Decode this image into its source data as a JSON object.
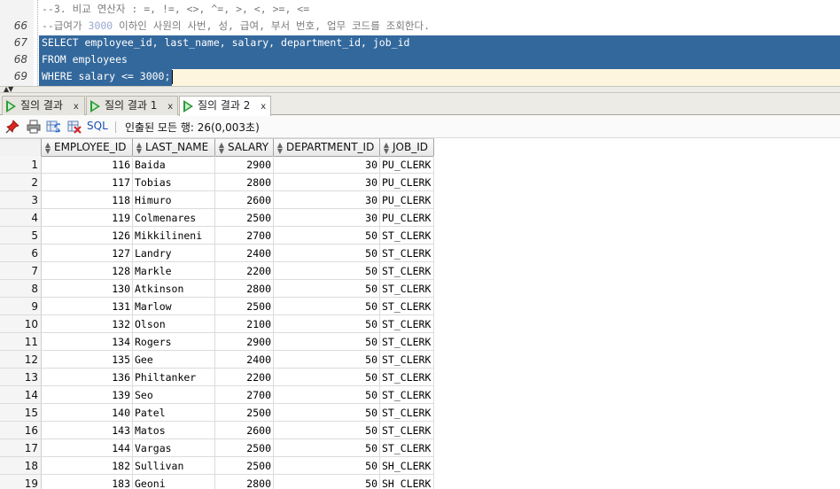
{
  "editor": {
    "lines": [
      {
        "num": "66",
        "text": "--3. 비교 연산자 : =, !=, <>, ^=, >, <, >=, <=",
        "kind": "comment"
      },
      {
        "num": "67",
        "pre": "--급여가 ",
        "numtext": "3000",
        "post": " 이하인 사원의 사번, 성, 급여, 부서 번호, 업무 코드를 조회한다.",
        "kind": "comment-num"
      },
      {
        "num": "68",
        "text": "SELECT employee_id, last_name, salary, department_id, job_id",
        "kind": "selected"
      },
      {
        "num": "69",
        "text": "FROM employees",
        "kind": "selected"
      },
      {
        "num": "70",
        "text": "WHERE salary <= 3000;",
        "kind": "selected-caret"
      }
    ]
  },
  "tabs": [
    {
      "label": "질의 결과",
      "close": "x",
      "active": false
    },
    {
      "label": "질의 결과 1",
      "close": "x",
      "active": false
    },
    {
      "label": "질의 결과 2",
      "close": "x",
      "active": true
    }
  ],
  "toolbar": {
    "sql_label": "SQL",
    "status": "인출된 모든 행: 26(0,003초)",
    "icons": [
      "pin-icon",
      "print-icon",
      "refresh-icon",
      "delete-icon"
    ]
  },
  "grid": {
    "columns": [
      "EMPLOYEE_ID",
      "LAST_NAME",
      "SALARY",
      "DEPARTMENT_ID",
      "JOB_ID"
    ],
    "rows": [
      {
        "n": "1",
        "emp": "116",
        "last": "Baida",
        "sal": "2900",
        "dept": "30",
        "job": "PU_CLERK"
      },
      {
        "n": "2",
        "emp": "117",
        "last": "Tobias",
        "sal": "2800",
        "dept": "30",
        "job": "PU_CLERK"
      },
      {
        "n": "3",
        "emp": "118",
        "last": "Himuro",
        "sal": "2600",
        "dept": "30",
        "job": "PU_CLERK"
      },
      {
        "n": "4",
        "emp": "119",
        "last": "Colmenares",
        "sal": "2500",
        "dept": "30",
        "job": "PU_CLERK"
      },
      {
        "n": "5",
        "emp": "126",
        "last": "Mikkilineni",
        "sal": "2700",
        "dept": "50",
        "job": "ST_CLERK"
      },
      {
        "n": "6",
        "emp": "127",
        "last": "Landry",
        "sal": "2400",
        "dept": "50",
        "job": "ST_CLERK"
      },
      {
        "n": "7",
        "emp": "128",
        "last": "Markle",
        "sal": "2200",
        "dept": "50",
        "job": "ST_CLERK"
      },
      {
        "n": "8",
        "emp": "130",
        "last": "Atkinson",
        "sal": "2800",
        "dept": "50",
        "job": "ST_CLERK"
      },
      {
        "n": "9",
        "emp": "131",
        "last": "Marlow",
        "sal": "2500",
        "dept": "50",
        "job": "ST_CLERK"
      },
      {
        "n": "10",
        "emp": "132",
        "last": "Olson",
        "sal": "2100",
        "dept": "50",
        "job": "ST_CLERK"
      },
      {
        "n": "11",
        "emp": "134",
        "last": "Rogers",
        "sal": "2900",
        "dept": "50",
        "job": "ST_CLERK"
      },
      {
        "n": "12",
        "emp": "135",
        "last": "Gee",
        "sal": "2400",
        "dept": "50",
        "job": "ST_CLERK"
      },
      {
        "n": "13",
        "emp": "136",
        "last": "Philtanker",
        "sal": "2200",
        "dept": "50",
        "job": "ST_CLERK"
      },
      {
        "n": "14",
        "emp": "139",
        "last": "Seo",
        "sal": "2700",
        "dept": "50",
        "job": "ST_CLERK"
      },
      {
        "n": "15",
        "emp": "140",
        "last": "Patel",
        "sal": "2500",
        "dept": "50",
        "job": "ST_CLERK"
      },
      {
        "n": "16",
        "emp": "143",
        "last": "Matos",
        "sal": "2600",
        "dept": "50",
        "job": "ST_CLERK"
      },
      {
        "n": "17",
        "emp": "144",
        "last": "Vargas",
        "sal": "2500",
        "dept": "50",
        "job": "ST_CLERK"
      },
      {
        "n": "18",
        "emp": "182",
        "last": "Sullivan",
        "sal": "2500",
        "dept": "50",
        "job": "SH_CLERK"
      },
      {
        "n": "19",
        "emp": "183",
        "last": "Geoni",
        "sal": "2800",
        "dept": "50",
        "job": "SH_CLERK"
      }
    ]
  }
}
